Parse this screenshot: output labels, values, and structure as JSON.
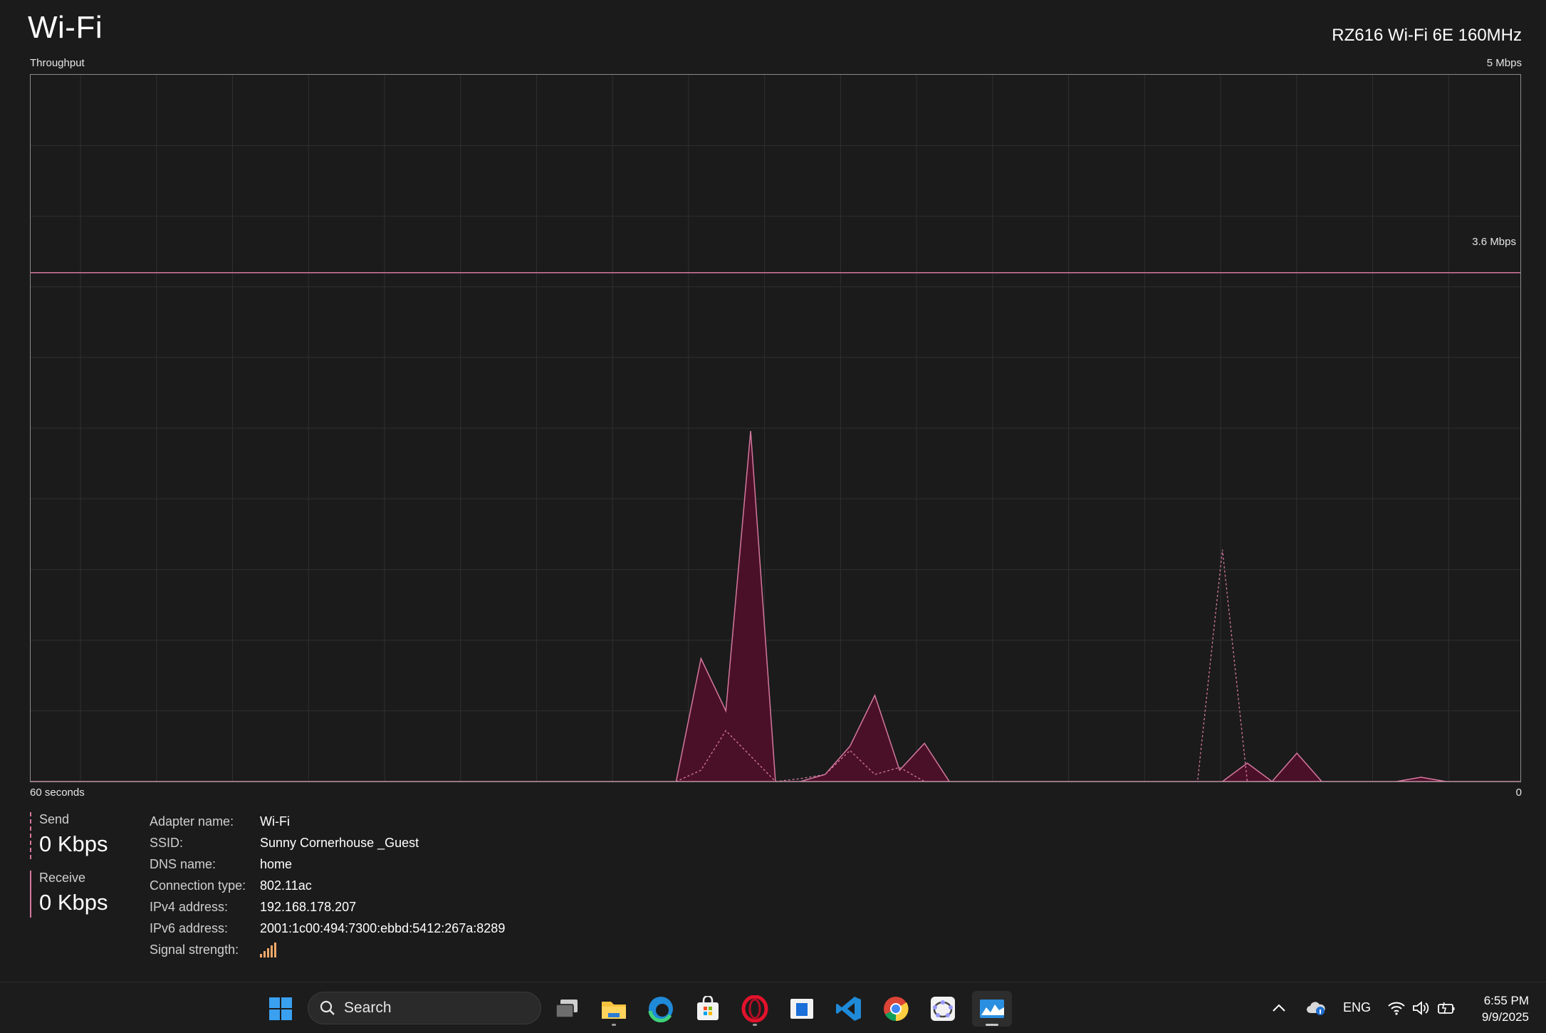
{
  "header": {
    "title": "Wi-Fi",
    "adapter_model": "RZ616 Wi-Fi 6E 160MHz"
  },
  "graph": {
    "label": "Throughput",
    "max_label": "5 Mbps",
    "reference_label": "3.6 Mbps",
    "x_left_label": "60 seconds",
    "x_right_label": "0",
    "line_color": "#d4789e",
    "fill_color": "#4a1028"
  },
  "chart_data": {
    "type": "area",
    "ylim": [
      0,
      5
    ],
    "reference_line": 3.6,
    "x": [
      60,
      59,
      58,
      57,
      56,
      55,
      54,
      53,
      52,
      51,
      50,
      49,
      48,
      47,
      46,
      45,
      44,
      43,
      42,
      41,
      40,
      39,
      38,
      37,
      36,
      35,
      34,
      33,
      32,
      31,
      30,
      29,
      28,
      27,
      26,
      25,
      24,
      23,
      22,
      21,
      20,
      19,
      18,
      17,
      16,
      15,
      14,
      13,
      12,
      11,
      10,
      9,
      8,
      7,
      6,
      5,
      4,
      3,
      2,
      1,
      0
    ],
    "series": [
      {
        "values": [
          0,
          0,
          0,
          0,
          0,
          0,
          0,
          0,
          0,
          0,
          0,
          0,
          0,
          0,
          0,
          0,
          0,
          0,
          0,
          0,
          0,
          0,
          0,
          0,
          0,
          0,
          0,
          0.87,
          0.5,
          2.48,
          0,
          0,
          0.05,
          0.25,
          0.61,
          0.08,
          0.27,
          0,
          0,
          0,
          0,
          0,
          0,
          0,
          0,
          0,
          0,
          0,
          0,
          0.13,
          0,
          0.2,
          0,
          0,
          0,
          0,
          0.03,
          0,
          0,
          0,
          0
        ]
      },
      {
        "values": [
          0,
          0,
          0,
          0,
          0,
          0,
          0,
          0,
          0,
          0,
          0,
          0,
          0,
          0,
          0,
          0,
          0,
          0,
          0,
          0,
          0,
          0,
          0,
          0,
          0,
          0,
          0,
          0.08,
          0.36,
          0.18,
          0,
          0.02,
          0.05,
          0.22,
          0.05,
          0.1,
          0,
          0,
          0,
          0,
          0,
          0,
          0,
          0,
          0,
          0,
          0,
          0,
          1.64,
          0,
          0,
          0,
          0,
          0,
          0,
          0,
          0.03,
          0,
          0,
          0,
          0
        ]
      }
    ]
  },
  "legend": {
    "send_label": "Send",
    "send_value": "0 Kbps",
    "receive_label": "Receive",
    "receive_value": "0 Kbps"
  },
  "details": [
    {
      "key": "Adapter name:",
      "value": "Wi-Fi"
    },
    {
      "key": "SSID:",
      "value": "Sunny Cornerhouse _Guest"
    },
    {
      "key": "DNS name:",
      "value": "home"
    },
    {
      "key": "Connection type:",
      "value": "802.11ac"
    },
    {
      "key": "IPv4 address:",
      "value": "192.168.178.207"
    },
    {
      "key": "IPv6 address:",
      "value": "2001:1c00:494:7300:ebbd:5412:267a:8289"
    },
    {
      "key": "Signal strength:",
      "value": ""
    }
  ],
  "signal_strength_bars": 5,
  "taskbar": {
    "search_placeholder": "Search",
    "icons": [
      "windows-start-icon",
      "task-view-icon",
      "file-explorer-icon",
      "edge-icon",
      "store-icon",
      "opera-icon",
      "snip-icon",
      "vscode-icon",
      "chrome-icon",
      "geogebra-icon",
      "task-manager-icon"
    ],
    "tray_language": "ENG",
    "time": "6:55 PM",
    "date": "9/9/2025"
  }
}
